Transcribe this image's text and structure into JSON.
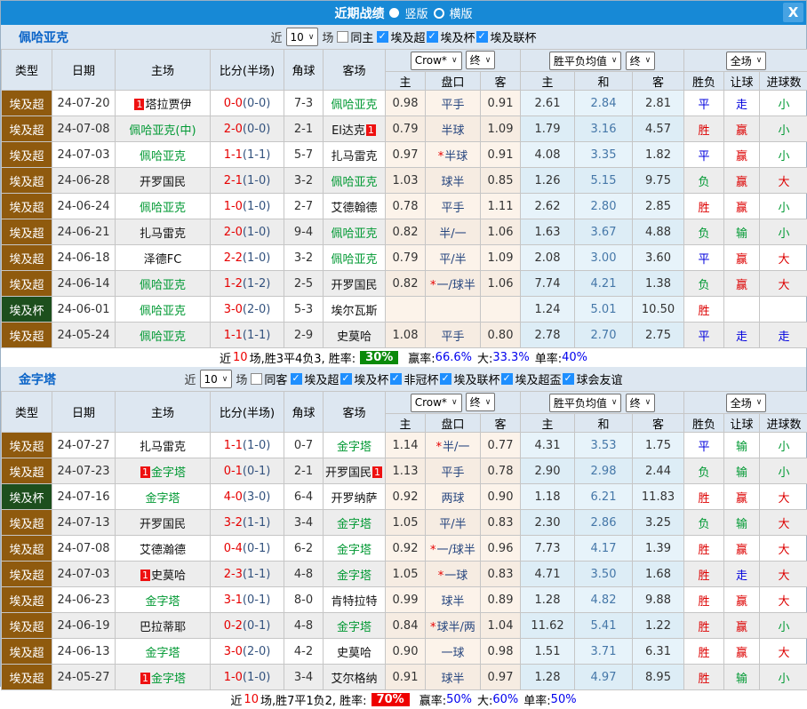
{
  "titlebar": {
    "title": "近期战绩",
    "vertical_label": "竖版",
    "horizontal_label": "横版",
    "close_label": "X"
  },
  "colors": {
    "titlebar_blue": "#1789d6",
    "accent_blue": "#0a64c8",
    "checkbox_blue": "#1e8fff",
    "type_brown": "#8f5a0e",
    "type_cup_green": "#1d4f1d",
    "team_green": "#009933",
    "score_red": "#e60000",
    "half_score_navy": "#33527e",
    "handicap_navy": "#26457e",
    "badge_red": "#ee1111",
    "result": {
      "red": "#dd0000",
      "blue": "#0000dd",
      "green": "#009933"
    },
    "rate_badge_green": "#0a8a0a",
    "rate_badge_red": "#ee0000",
    "odds_col_bg": "#fcf3ea",
    "mean_col_bg": "#e7f3fa"
  },
  "columns": {
    "type": "类型",
    "date": "日期",
    "home": "主场",
    "score": "比分(半场)",
    "corner": "角球",
    "away": "客场"
  },
  "table_controls": {
    "provider": "Crow*",
    "provider_state": "终",
    "mean": "胜平负均值",
    "mean_state": "终",
    "scope": "全场"
  },
  "sub_columns": {
    "home": "主",
    "handicap": "盘口",
    "away": "客",
    "mean_home": "主",
    "mean_draw": "和",
    "mean_away": "客",
    "wdl": "胜负",
    "handicap_result": "让球",
    "goals": "进球数"
  },
  "sections": [
    {
      "team": "佩哈亚克",
      "filter": {
        "near": "近",
        "count": "10",
        "games": "场",
        "same": "同主",
        "same_checked": false,
        "leagues": [
          {
            "label": "埃及超",
            "checked": true
          },
          {
            "label": "埃及杯",
            "checked": true
          },
          {
            "label": "埃及联杯",
            "checked": true
          }
        ]
      },
      "rows": [
        {
          "type": "埃及超",
          "ts": "brown",
          "date": "24-07-20",
          "hb": "1",
          "home": "塔拉贾伊",
          "hg": 0,
          "ft": "0-0",
          "ht": "(0-0)",
          "corner": "7-3",
          "away": "佩哈亚克",
          "ag": 1,
          "ab": "",
          "o1": "0.98",
          "hc": "平手",
          "st": 0,
          "o2": "0.91",
          "m1": "2.61",
          "m2": "2.84",
          "m3": "2.81",
          "r1": "平",
          "c1": "blue",
          "r2": "走",
          "c2": "blue",
          "r3": "小",
          "c3": "green"
        },
        {
          "type": "埃及超",
          "ts": "brown",
          "date": "24-07-08",
          "hb": "",
          "home": "佩哈亚克(中)",
          "hg": 1,
          "ft": "2-0",
          "ht": "(0-0)",
          "corner": "2-1",
          "away": "El达克",
          "ag": 0,
          "ab": "1",
          "o1": "0.79",
          "hc": "半球",
          "st": 0,
          "o2": "1.09",
          "m1": "1.79",
          "m2": "3.16",
          "m3": "4.57",
          "r1": "胜",
          "c1": "red",
          "r2": "赢",
          "c2": "red",
          "r3": "小",
          "c3": "green"
        },
        {
          "type": "埃及超",
          "ts": "brown",
          "date": "24-07-03",
          "hb": "",
          "home": "佩哈亚克",
          "hg": 1,
          "ft": "1-1",
          "ht": "(1-1)",
          "corner": "5-7",
          "away": "扎马雷克",
          "ag": 0,
          "ab": "",
          "o1": "0.97",
          "hc": "半球",
          "st": 1,
          "o2": "0.91",
          "m1": "4.08",
          "m2": "3.35",
          "m3": "1.82",
          "r1": "平",
          "c1": "blue",
          "r2": "赢",
          "c2": "red",
          "r3": "小",
          "c3": "green"
        },
        {
          "type": "埃及超",
          "ts": "brown",
          "date": "24-06-28",
          "hb": "",
          "home": "开罗国民",
          "hg": 0,
          "ft": "2-1",
          "ht": "(1-0)",
          "corner": "3-2",
          "away": "佩哈亚克",
          "ag": 1,
          "ab": "",
          "o1": "1.03",
          "hc": "球半",
          "st": 0,
          "o2": "0.85",
          "m1": "1.26",
          "m2": "5.15",
          "m3": "9.75",
          "r1": "负",
          "c1": "green",
          "r2": "赢",
          "c2": "red",
          "r3": "大",
          "c3": "red"
        },
        {
          "type": "埃及超",
          "ts": "brown",
          "date": "24-06-24",
          "hb": "",
          "home": "佩哈亚克",
          "hg": 1,
          "ft": "1-0",
          "ht": "(1-0)",
          "corner": "2-7",
          "away": "艾德翰德",
          "ag": 0,
          "ab": "",
          "o1": "0.78",
          "hc": "平手",
          "st": 0,
          "o2": "1.11",
          "m1": "2.62",
          "m2": "2.80",
          "m3": "2.85",
          "r1": "胜",
          "c1": "red",
          "r2": "赢",
          "c2": "red",
          "r3": "小",
          "c3": "green"
        },
        {
          "type": "埃及超",
          "ts": "brown",
          "date": "24-06-21",
          "hb": "",
          "home": "扎马雷克",
          "hg": 0,
          "ft": "2-0",
          "ht": "(1-0)",
          "corner": "9-4",
          "away": "佩哈亚克",
          "ag": 1,
          "ab": "",
          "o1": "0.82",
          "hc": "半/一",
          "st": 0,
          "o2": "1.06",
          "m1": "1.63",
          "m2": "3.67",
          "m3": "4.88",
          "r1": "负",
          "c1": "green",
          "r2": "输",
          "c2": "green",
          "r3": "小",
          "c3": "green"
        },
        {
          "type": "埃及超",
          "ts": "brown",
          "date": "24-06-18",
          "hb": "",
          "home": "泽德FC",
          "hg": 0,
          "ft": "2-2",
          "ht": "(1-0)",
          "corner": "3-2",
          "away": "佩哈亚克",
          "ag": 1,
          "ab": "",
          "o1": "0.79",
          "hc": "平/半",
          "st": 0,
          "o2": "1.09",
          "m1": "2.08",
          "m2": "3.00",
          "m3": "3.60",
          "r1": "平",
          "c1": "blue",
          "r2": "赢",
          "c2": "red",
          "r3": "大",
          "c3": "red"
        },
        {
          "type": "埃及超",
          "ts": "brown",
          "date": "24-06-14",
          "hb": "",
          "home": "佩哈亚克",
          "hg": 1,
          "ft": "1-2",
          "ht": "(1-2)",
          "corner": "2-5",
          "away": "开罗国民",
          "ag": 0,
          "ab": "",
          "o1": "0.82",
          "hc": "一/球半",
          "st": 1,
          "o2": "1.06",
          "m1": "7.74",
          "m2": "4.21",
          "m3": "1.38",
          "r1": "负",
          "c1": "green",
          "r2": "赢",
          "c2": "red",
          "r3": "大",
          "c3": "red"
        },
        {
          "type": "埃及杯",
          "ts": "green",
          "date": "24-06-01",
          "hb": "",
          "home": "佩哈亚克",
          "hg": 1,
          "ft": "3-0",
          "ht": "(2-0)",
          "corner": "5-3",
          "away": "埃尔瓦斯",
          "ag": 0,
          "ab": "",
          "o1": "",
          "hc": "",
          "st": 0,
          "o2": "",
          "m1": "1.24",
          "m2": "5.01",
          "m3": "10.50",
          "r1": "胜",
          "c1": "red",
          "r2": "",
          "c2": "",
          "r3": "",
          "c3": ""
        },
        {
          "type": "埃及超",
          "ts": "brown",
          "date": "24-05-24",
          "hb": "",
          "home": "佩哈亚克",
          "hg": 1,
          "ft": "1-1",
          "ht": "(1-1)",
          "corner": "2-9",
          "away": "史莫哈",
          "ag": 0,
          "ab": "",
          "o1": "1.08",
          "hc": "平手",
          "st": 0,
          "o2": "0.80",
          "m1": "2.78",
          "m2": "2.70",
          "m3": "2.75",
          "r1": "平",
          "c1": "blue",
          "r2": "走",
          "c2": "blue",
          "r3": "走",
          "c3": "blue"
        }
      ],
      "summary": {
        "lead": "近",
        "count": "10",
        "rest": "场,胜3平4负3, 胜率:",
        "rate": "30%",
        "rate_class": "rate green",
        "stats": [
          {
            "label": "赢率:",
            "value": "66.6%"
          },
          {
            "label": "大:",
            "value": "33.3%"
          },
          {
            "label": "单率:",
            "value": "40%"
          }
        ]
      }
    },
    {
      "team": "金字塔",
      "filter": {
        "near": "近",
        "count": "10",
        "games": "场",
        "same": "同客",
        "same_checked": false,
        "leagues": [
          {
            "label": "埃及超",
            "checked": true
          },
          {
            "label": "埃及杯",
            "checked": true
          },
          {
            "label": "非冠杯",
            "checked": true
          },
          {
            "label": "埃及联杯",
            "checked": true
          },
          {
            "label": "埃及超盃",
            "checked": true
          },
          {
            "label": "球会友谊",
            "checked": true
          }
        ]
      },
      "rows": [
        {
          "type": "埃及超",
          "ts": "brown",
          "date": "24-07-27",
          "hb": "",
          "home": "扎马雷克",
          "hg": 0,
          "ft": "1-1",
          "ht": "(1-0)",
          "corner": "0-7",
          "away": "金字塔",
          "ag": 1,
          "ab": "",
          "o1": "1.14",
          "hc": "半/一",
          "st": 1,
          "o2": "0.77",
          "m1": "4.31",
          "m2": "3.53",
          "m3": "1.75",
          "r1": "平",
          "c1": "blue",
          "r2": "输",
          "c2": "green",
          "r3": "小",
          "c3": "green"
        },
        {
          "type": "埃及超",
          "ts": "brown",
          "date": "24-07-23",
          "hb": "1",
          "home": "金字塔",
          "hg": 1,
          "ft": "0-1",
          "ht": "(0-1)",
          "corner": "2-1",
          "away": "开罗国民",
          "ag": 0,
          "ab": "1",
          "o1": "1.13",
          "hc": "平手",
          "st": 0,
          "o2": "0.78",
          "m1": "2.90",
          "m2": "2.98",
          "m3": "2.44",
          "r1": "负",
          "c1": "green",
          "r2": "输",
          "c2": "green",
          "r3": "小",
          "c3": "green"
        },
        {
          "type": "埃及杯",
          "ts": "green",
          "date": "24-07-16",
          "hb": "",
          "home": "金字塔",
          "hg": 1,
          "ft": "4-0",
          "ht": "(3-0)",
          "corner": "6-4",
          "away": "开罗纳萨",
          "ag": 0,
          "ab": "",
          "o1": "0.92",
          "hc": "两球",
          "st": 0,
          "o2": "0.90",
          "m1": "1.18",
          "m2": "6.21",
          "m3": "11.83",
          "r1": "胜",
          "c1": "red",
          "r2": "赢",
          "c2": "red",
          "r3": "大",
          "c3": "red"
        },
        {
          "type": "埃及超",
          "ts": "brown",
          "date": "24-07-13",
          "hb": "",
          "home": "开罗国民",
          "hg": 0,
          "ft": "3-2",
          "ht": "(1-1)",
          "corner": "3-4",
          "away": "金字塔",
          "ag": 1,
          "ab": "",
          "o1": "1.05",
          "hc": "平/半",
          "st": 0,
          "o2": "0.83",
          "m1": "2.30",
          "m2": "2.86",
          "m3": "3.25",
          "r1": "负",
          "c1": "green",
          "r2": "输",
          "c2": "green",
          "r3": "大",
          "c3": "red"
        },
        {
          "type": "埃及超",
          "ts": "brown",
          "date": "24-07-08",
          "hb": "",
          "home": "艾德瀚德",
          "hg": 0,
          "ft": "0-4",
          "ht": "(0-1)",
          "corner": "6-2",
          "away": "金字塔",
          "ag": 1,
          "ab": "",
          "o1": "0.92",
          "hc": "一/球半",
          "st": 1,
          "o2": "0.96",
          "m1": "7.73",
          "m2": "4.17",
          "m3": "1.39",
          "r1": "胜",
          "c1": "red",
          "r2": "赢",
          "c2": "red",
          "r3": "大",
          "c3": "red"
        },
        {
          "type": "埃及超",
          "ts": "brown",
          "date": "24-07-03",
          "hb": "1",
          "home": "史莫哈",
          "hg": 0,
          "ft": "2-3",
          "ht": "(1-1)",
          "corner": "4-8",
          "away": "金字塔",
          "ag": 1,
          "ab": "",
          "o1": "1.05",
          "hc": "一球",
          "st": 1,
          "o2": "0.83",
          "m1": "4.71",
          "m2": "3.50",
          "m3": "1.68",
          "r1": "胜",
          "c1": "red",
          "r2": "走",
          "c2": "blue",
          "r3": "大",
          "c3": "red"
        },
        {
          "type": "埃及超",
          "ts": "brown",
          "date": "24-06-23",
          "hb": "",
          "home": "金字塔",
          "hg": 1,
          "ft": "3-1",
          "ht": "(0-1)",
          "corner": "8-0",
          "away": "肯特拉特",
          "ag": 0,
          "ab": "",
          "o1": "0.99",
          "hc": "球半",
          "st": 0,
          "o2": "0.89",
          "m1": "1.28",
          "m2": "4.82",
          "m3": "9.88",
          "r1": "胜",
          "c1": "red",
          "r2": "赢",
          "c2": "red",
          "r3": "大",
          "c3": "red"
        },
        {
          "type": "埃及超",
          "ts": "brown",
          "date": "24-06-19",
          "hb": "",
          "home": "巴拉蒂耶",
          "hg": 0,
          "ft": "0-2",
          "ht": "(0-1)",
          "corner": "4-8",
          "away": "金字塔",
          "ag": 1,
          "ab": "",
          "o1": "0.84",
          "hc": "球半/两",
          "st": 1,
          "o2": "1.04",
          "m1": "11.62",
          "m2": "5.41",
          "m3": "1.22",
          "r1": "胜",
          "c1": "red",
          "r2": "赢",
          "c2": "red",
          "r3": "小",
          "c3": "green"
        },
        {
          "type": "埃及超",
          "ts": "brown",
          "date": "24-06-13",
          "hb": "",
          "home": "金字塔",
          "hg": 1,
          "ft": "3-0",
          "ht": "(2-0)",
          "corner": "4-2",
          "away": "史莫哈",
          "ag": 0,
          "ab": "",
          "o1": "0.90",
          "hc": "一球",
          "st": 0,
          "o2": "0.98",
          "m1": "1.51",
          "m2": "3.71",
          "m3": "6.31",
          "r1": "胜",
          "c1": "red",
          "r2": "赢",
          "c2": "red",
          "r3": "大",
          "c3": "red"
        },
        {
          "type": "埃及超",
          "ts": "brown",
          "date": "24-05-27",
          "hb": "1",
          "home": "金字塔",
          "hg": 1,
          "ft": "1-0",
          "ht": "(1-0)",
          "corner": "3-4",
          "away": "艾尔格纳",
          "ag": 0,
          "ab": "",
          "o1": "0.91",
          "hc": "球半",
          "st": 0,
          "o2": "0.97",
          "m1": "1.28",
          "m2": "4.97",
          "m3": "8.95",
          "r1": "胜",
          "c1": "red",
          "r2": "输",
          "c2": "green",
          "r3": "小",
          "c3": "green"
        }
      ],
      "summary": {
        "lead": "近",
        "count": "10",
        "rest": "场,胜7平1负2, 胜率:",
        "rate": "70%",
        "rate_class": "rate red",
        "stats": [
          {
            "label": "赢率:",
            "value": "50%"
          },
          {
            "label": "大:",
            "value": "60%"
          },
          {
            "label": "单率:",
            "value": "50%"
          }
        ]
      }
    }
  ]
}
